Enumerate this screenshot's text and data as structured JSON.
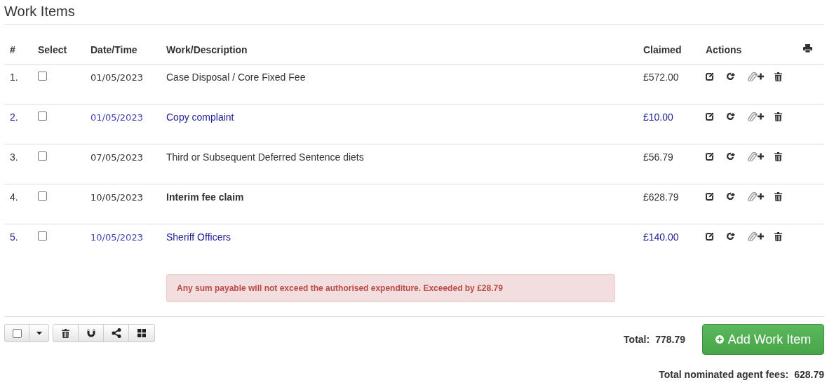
{
  "title": "Work Items",
  "columns": [
    "#",
    "Select",
    "Date/Time",
    "Work/Description",
    "Claimed",
    "Actions"
  ],
  "rows": [
    {
      "number": "1.",
      "checked": false,
      "date": "01/05/2023",
      "description": "Case Disposal / Core Fixed Fee",
      "claimed": "£572.00",
      "kind": "plain",
      "bold": false
    },
    {
      "number": "2.",
      "checked": false,
      "date": "01/05/2023",
      "description": "Copy complaint",
      "claimed": "£10.00",
      "kind": "link",
      "bold": false
    },
    {
      "number": "3.",
      "checked": false,
      "date": "07/05/2023",
      "description": "Third or Subsequent Deferred Sentence diets",
      "claimed": "£56.79",
      "kind": "plain",
      "bold": false
    },
    {
      "number": "4.",
      "checked": false,
      "date": "10/05/2023",
      "description": "Interim fee claim",
      "claimed": "£628.79",
      "kind": "plain",
      "bold": true
    },
    {
      "number": "5.",
      "checked": false,
      "date": "10/05/2023",
      "description": "Sheriff Officers",
      "claimed": "£140.00",
      "kind": "link",
      "bold": false,
      "alert": "Any sum payable will not exceed the authorised expenditure. Exceeded by £28.79"
    }
  ],
  "toolbar": {
    "select_all_checked": false
  },
  "total_label": "Total:",
  "total": "778.79",
  "add_button": "Add Work Item",
  "nominated_label": "Total nominated agent fees:",
  "nominated": "628.79"
}
